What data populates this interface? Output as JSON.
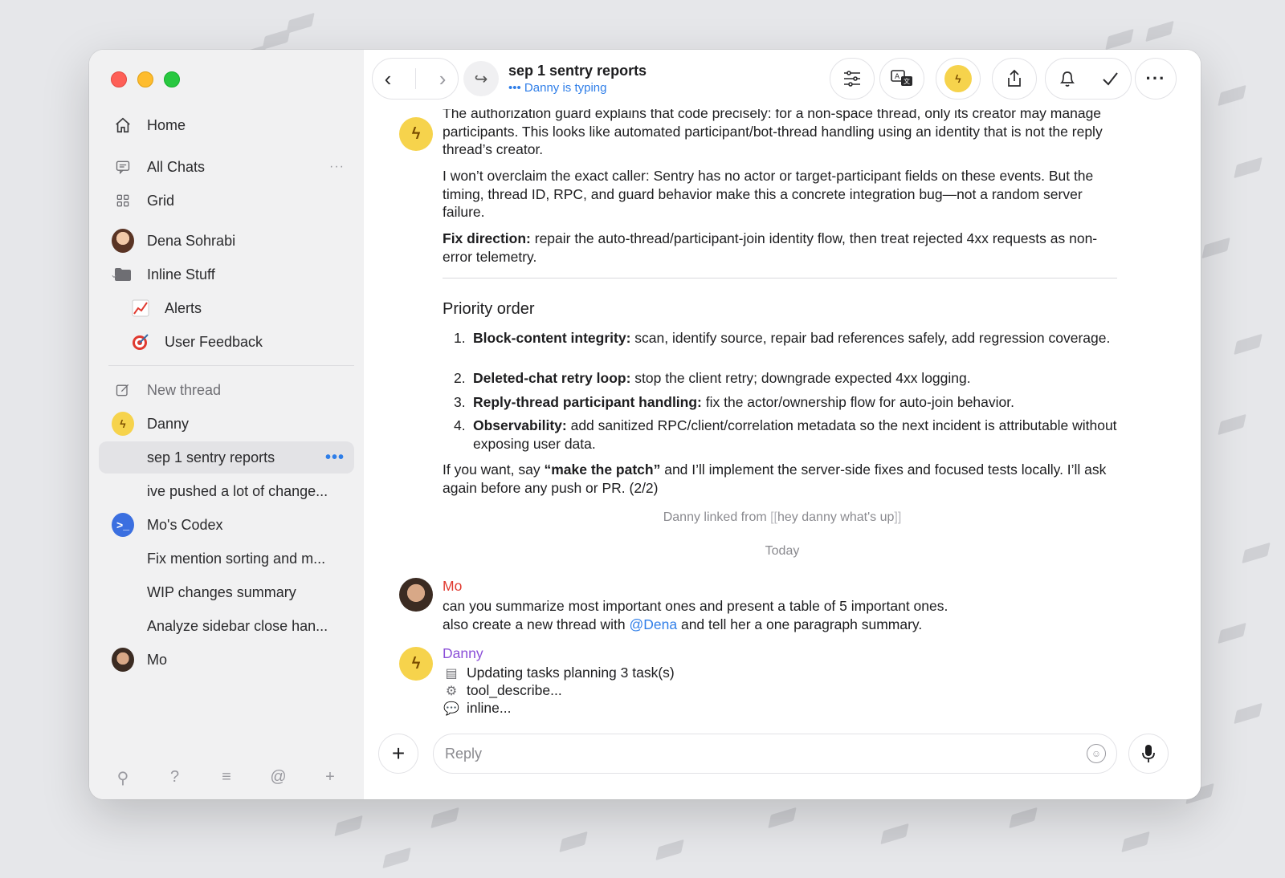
{
  "window": {
    "title": "sep 1 sentry reports",
    "typing_status": "Danny is typing"
  },
  "sidebar": {
    "home": "Home",
    "all_chats": "All Chats",
    "all_chats_more": "···",
    "grid": "Grid",
    "dena": "Dena Sohrabi",
    "inline_stuff": "Inline Stuff",
    "alerts": "Alerts",
    "user_feedback": "User Feedback",
    "new_thread": "New thread",
    "danny": "Danny",
    "thread_selected": "sep 1 sentry reports",
    "thread_selected_more": "•••",
    "thread_2": "ive pushed a lot of change...",
    "mos_codex": "Mo's Codex",
    "codex_1": "Fix mention sorting and m...",
    "codex_2": "WIP changes summary",
    "codex_3": "Analyze sidebar close han...",
    "mo": "Mo"
  },
  "messages": {
    "p1": "The authorization guard explains that code precisely: for a non-space thread, only its creator may manage participants. This looks like automated participant/bot-thread handling using an identity that is not the reply thread’s creator.",
    "p2": "I won’t overclaim the exact caller: Sentry has no actor or target-participant fields on these events. But the timing, thread ID, RPC, and guard behavior make this a concrete integration bug—not a random server failure.",
    "p3_bold": "Fix direction:",
    "p3_rest": " repair the auto-thread/participant-join identity flow, then treat rejected 4xx requests as non-error telemetry.",
    "heading": "Priority order",
    "list": [
      {
        "num": "1.",
        "bold": "Block-content integrity:",
        "rest": " scan, identify source, repair bad references safely, add regression coverage."
      },
      {
        "num": "2.",
        "bold": "Deleted-chat retry loop:",
        "rest": " stop the client retry; downgrade expected 4xx logging."
      },
      {
        "num": "3.",
        "bold": "Reply-thread participant handling:",
        "rest": " fix the actor/ownership flow for auto-join behavior."
      },
      {
        "num": "4.",
        "bold": "Observability:",
        "rest": " add sanitized RPC/client/correlation metadata so the next incident is attributable without exposing user data."
      }
    ],
    "p4_pre": "If you want, say ",
    "p4_bold": "“make the patch”",
    "p4_post": " and I’ll implement the server-side fixes and focused tests locally. I’ll ask again before any push or PR. (2/2)",
    "linked_pre": "Danny linked from ",
    "linked_open": "[[",
    "linked_text": "hey danny what's up",
    "linked_close": "]]",
    "day_separator": "Today",
    "mo_sender": "Mo",
    "mo_line1": "can you summarize most important ones and present a table of 5 important ones.",
    "mo_line2_pre": "also create a new thread with ",
    "mo_mention": "@Dena",
    "mo_line2_post": " and tell her a one paragraph summary.",
    "danny_sender": "Danny",
    "tasks": [
      {
        "icon": "clipboard-icon",
        "glyph": "▤",
        "text": "Updating tasks planning 3 task(s)"
      },
      {
        "icon": "gear-icon",
        "glyph": "⚙",
        "text": "tool_describe..."
      },
      {
        "icon": "speech-bubble-icon",
        "glyph": "💬",
        "text": "inline..."
      }
    ]
  },
  "composer": {
    "placeholder": "Reply"
  },
  "colors": {
    "accent": "#2f7ee8",
    "mo_name": "#e0392f",
    "danny_name": "#8b4fd8"
  }
}
